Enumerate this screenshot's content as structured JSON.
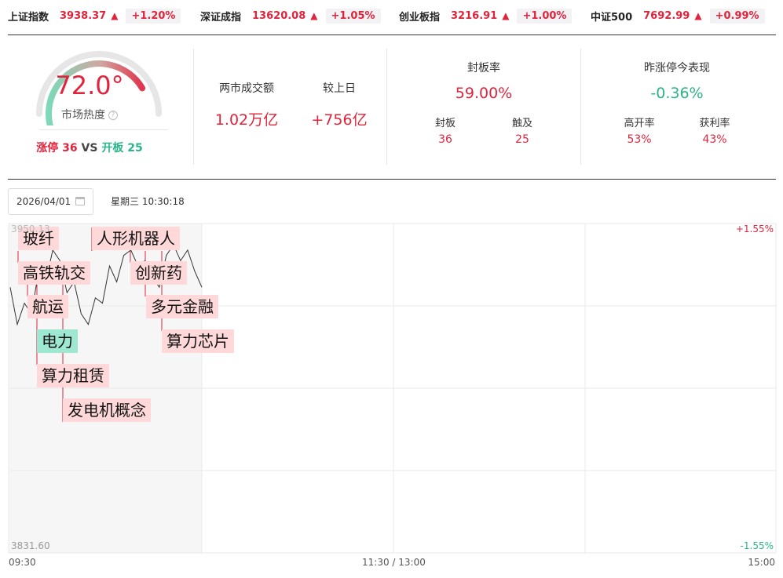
{
  "tickers": [
    {
      "name": "上证指数",
      "value": "3938.37",
      "arrow": "▲",
      "change": "+1.20%"
    },
    {
      "name": "深证成指",
      "value": "13620.08",
      "arrow": "▲",
      "change": "+1.05%"
    },
    {
      "name": "创业板指",
      "value": "3216.91",
      "arrow": "▲",
      "change": "+1.00%"
    },
    {
      "name": "中证500",
      "value": "7692.99",
      "arrow": "▲",
      "change": "+0.99%"
    }
  ],
  "gauge": {
    "value": "72.0°",
    "level": 0.72,
    "label": "市场热度",
    "info_glyph": "?",
    "limit_up_label": "涨停",
    "limit_up_count": "36",
    "vs": "VS",
    "open_board_label": "开板",
    "open_board_count": "25"
  },
  "turnover": {
    "label": "两市成交额",
    "value": "1.02万亿",
    "compare_label": "较上日",
    "compare_value": "+756亿"
  },
  "seal_rate": {
    "label": "封板率",
    "value": "59.00%",
    "sealed_label": "封板",
    "sealed_value": "36",
    "touched_label": "触及",
    "touched_value": "25"
  },
  "yesterday": {
    "label": "昨涨停今表现",
    "value": "-0.36%",
    "high_open_label": "高开率",
    "high_open_value": "53%",
    "profit_label": "获利率",
    "profit_value": "43%"
  },
  "date_picker": {
    "date": "2026/04/01"
  },
  "time_label": "星期三 10:30:18",
  "chart": {
    "y_top_label": "+1.55%",
    "y_bottom_label": "-1.55%",
    "price_top": "3950.13",
    "price_bottom": "3831.60",
    "x_start": "09:30",
    "x_mid": "11:30 / 13:00",
    "x_end": "15:00"
  },
  "chart_data": {
    "type": "line",
    "series": [
      {
        "values": [
          0.95,
          0.6,
          0.8,
          0.7,
          1.1,
          1.0,
          1.3,
          1.2,
          0.9,
          1.0,
          0.7,
          0.6,
          0.85,
          0.8,
          1.15,
          1.0,
          1.25,
          1.3,
          1.15,
          1.2,
          1.05,
          0.95,
          1.25,
          1.35,
          1.2,
          1.3,
          1.1,
          0.95
        ]
      }
    ],
    "ylim": [
      -1.55,
      1.55
    ],
    "annotations": [
      "玻纤",
      "高铁轨交",
      "航运",
      "电力",
      "算力租赁",
      "发电机概念",
      "人形机器人",
      "创新药",
      "多元金融",
      "算力芯片"
    ]
  }
}
